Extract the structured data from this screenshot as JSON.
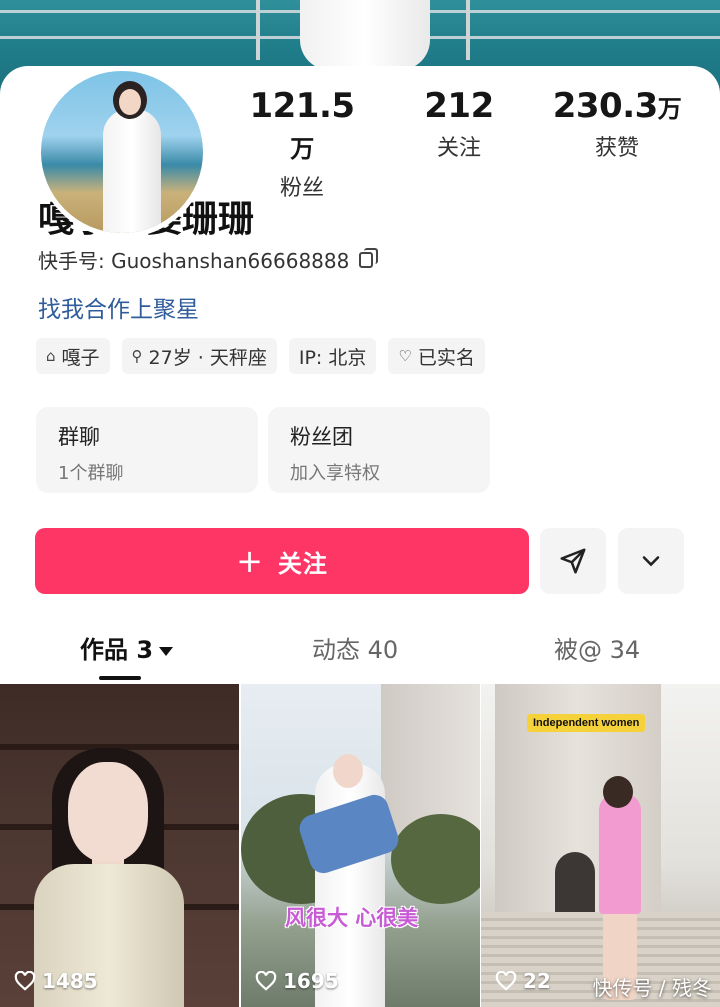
{
  "profile": {
    "nickname": "嘎子老婆珊珊",
    "kuaishou_id": "快手号: Guoshanshan66668888",
    "cooperation": "找我合作上聚星",
    "stats": [
      {
        "num": "121.5",
        "unit": "万",
        "label": "粉丝"
      },
      {
        "num": "212",
        "unit": "",
        "label": "关注"
      },
      {
        "num": "230.3",
        "unit": "万",
        "label": "获赞"
      }
    ],
    "tags": [
      {
        "icon": "home-icon",
        "glyph": "⌂",
        "text": "嘎子"
      },
      {
        "icon": "gender-icon",
        "glyph": "⚲",
        "text": "27岁 · 天秤座"
      },
      {
        "icon": "",
        "glyph": "",
        "text": "IP: 北京"
      },
      {
        "icon": "verified-icon",
        "glyph": "♡",
        "text": "已实名"
      }
    ]
  },
  "cards": [
    {
      "title": "群聊",
      "subtitle": "1个群聊"
    },
    {
      "title": "粉丝团",
      "subtitle": "加入享特权"
    }
  ],
  "actions": {
    "follow_plus": "+",
    "follow_label": "关注"
  },
  "tabs": [
    {
      "label": "作品 3",
      "active": true
    },
    {
      "label": "动态 40",
      "active": false
    },
    {
      "label": "被@ 34",
      "active": false
    }
  ],
  "videos": [
    {
      "likes": "1485",
      "caption": ""
    },
    {
      "likes": "1695",
      "caption": "风很大 心很美"
    },
    {
      "likes": "22",
      "caption": "",
      "badge": "Independent women"
    }
  ],
  "watermark": "快传号 / 残冬",
  "colors": {
    "accent": "#fe3666",
    "link": "#2f5c9b",
    "caption": "#c85ad6",
    "badge": "#f6d23a"
  }
}
